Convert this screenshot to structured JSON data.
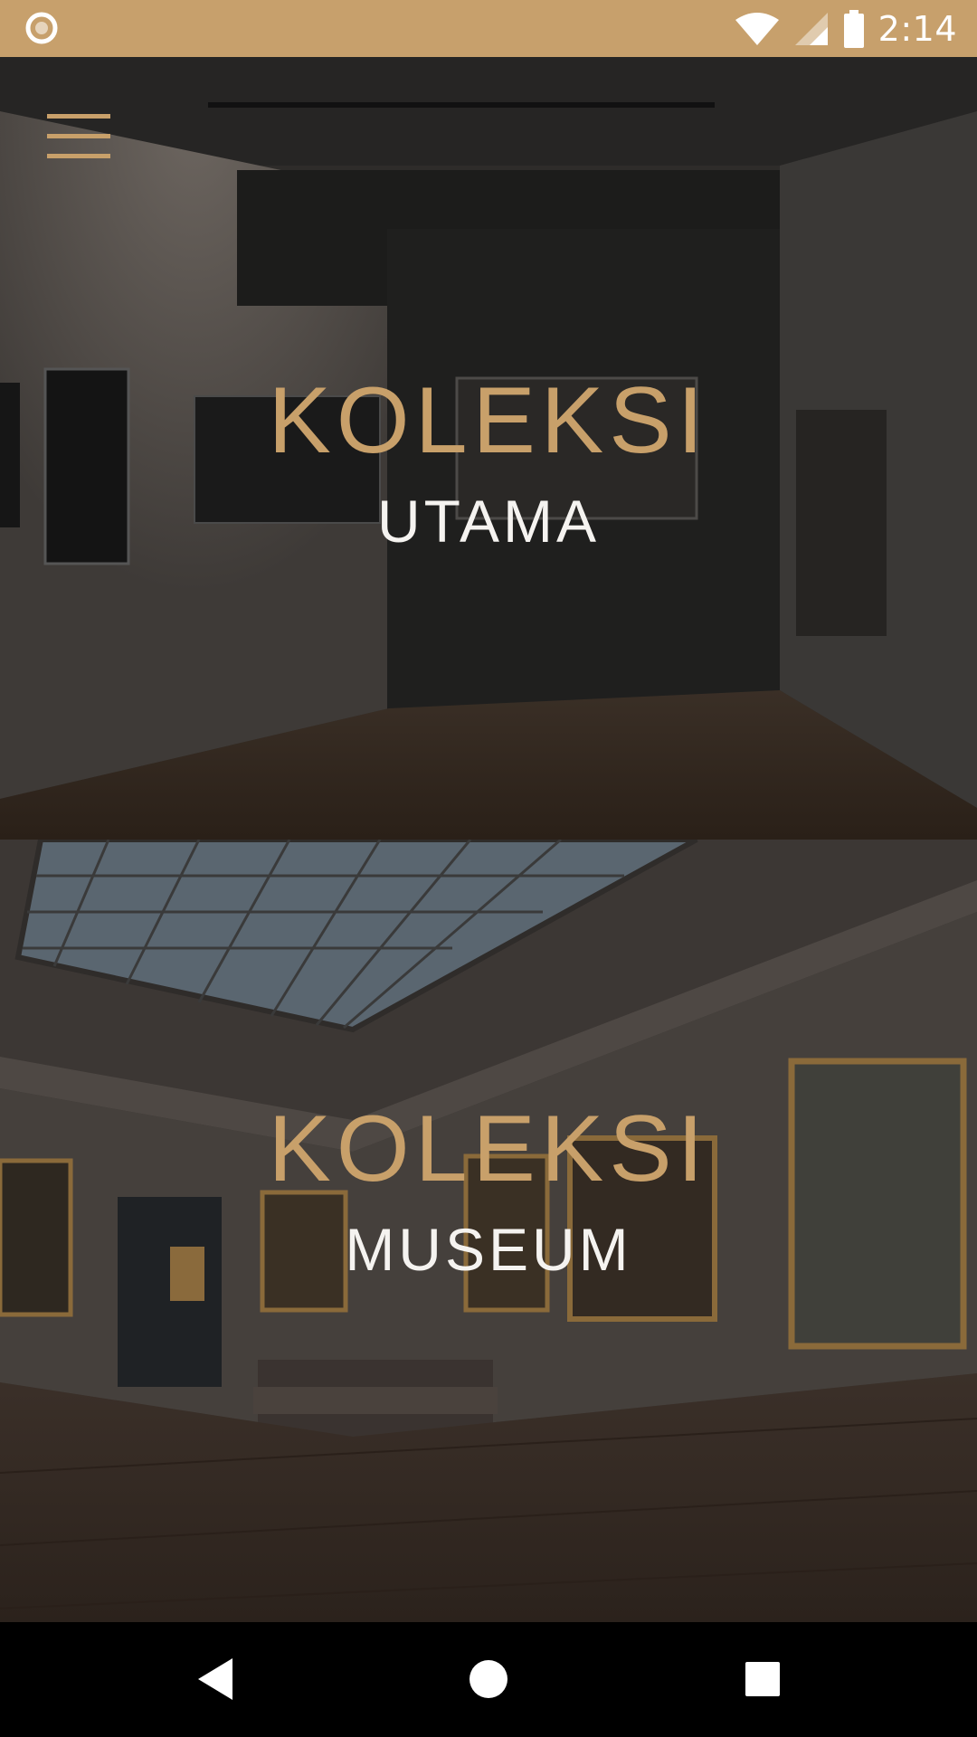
{
  "status_bar": {
    "time": "2:14",
    "background": "#c7a06c",
    "icons": [
      "record-icon",
      "wifi-icon",
      "signal-icon",
      "battery-icon"
    ]
  },
  "menu": {
    "icon": "hamburger-menu-icon",
    "color": "#c8a06a"
  },
  "collections": [
    {
      "title": "KOLEKSI",
      "subtitle": "UTAMA"
    },
    {
      "title": "KOLEKSI",
      "subtitle": "MUSEUM"
    }
  ],
  "nav_bar": {
    "icons": [
      "back-icon",
      "home-icon",
      "recents-icon"
    ]
  },
  "colors": {
    "accent": "#c8a06a",
    "subtitle": "#f5f3f0"
  }
}
